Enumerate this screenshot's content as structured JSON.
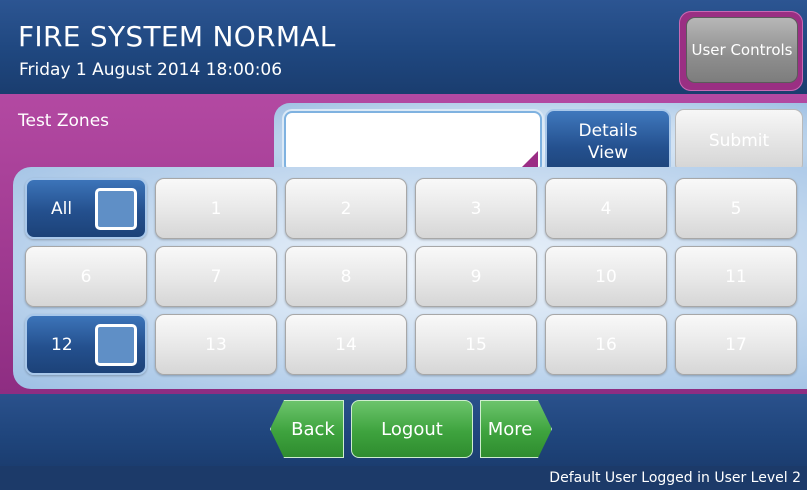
{
  "header": {
    "title": "FIRE SYSTEM NORMAL",
    "datetime": "Friday 1 August 2014 18:00:06",
    "user_controls_label": "User Controls"
  },
  "panel": {
    "label": "Test Zones",
    "entry_value": "",
    "details_label_line1": "Details",
    "details_label_line2": "View",
    "submit_label": "Submit"
  },
  "zones": {
    "all": "All",
    "z1": "1",
    "z2": "2",
    "z3": "3",
    "z4": "4",
    "z5": "5",
    "z6": "6",
    "z7": "7",
    "z8": "8",
    "z9": "9",
    "z10": "10",
    "z11": "11",
    "z12": "12",
    "z13": "13",
    "z14": "14",
    "z15": "15",
    "z16": "16",
    "z17": "17"
  },
  "nav": {
    "back": "Back",
    "logout": "Logout",
    "more": "More"
  },
  "status": {
    "text": "Default User Logged in User Level 2"
  },
  "colors": {
    "header_blue": "#1f477f",
    "panel_purple": "#a13b92",
    "selected_blue": "#24508e",
    "nav_green": "#3ea33e"
  }
}
